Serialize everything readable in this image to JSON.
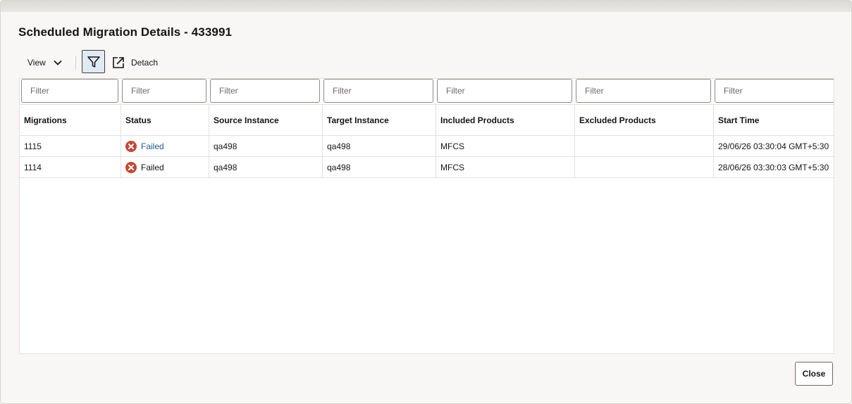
{
  "dialog": {
    "title": "Scheduled Migration Details - 433991",
    "close_label": "Close"
  },
  "toolbar": {
    "view_label": "View",
    "detach_label": "Detach"
  },
  "table": {
    "filter_placeholder": "Filter",
    "columns": [
      "Migrations",
      "Status",
      "Source Instance",
      "Target Instance",
      "Included Products",
      "Excluded Products",
      "Start Time"
    ],
    "rows": [
      {
        "migration": "1115",
        "status": "Failed",
        "source": "qa498",
        "target": "qa498",
        "included": "MFCS",
        "excluded": "",
        "start": "29/06/26 03:30:04 GMT+5:30"
      },
      {
        "migration": "1114",
        "status": "Failed",
        "source": "qa498",
        "target": "qa498",
        "included": "MFCS",
        "excluded": "",
        "start": "28/06/26 03:30:03 GMT+5:30"
      }
    ]
  },
  "colors": {
    "error_icon": "#c74634",
    "link": "#1e5b8c",
    "filter_active_bg": "#dfeaf3"
  },
  "icons": {
    "view_chevron": "chevron-down-icon",
    "filter": "funnel-icon",
    "detach": "detach-icon",
    "status_error": "error-circle-icon"
  }
}
